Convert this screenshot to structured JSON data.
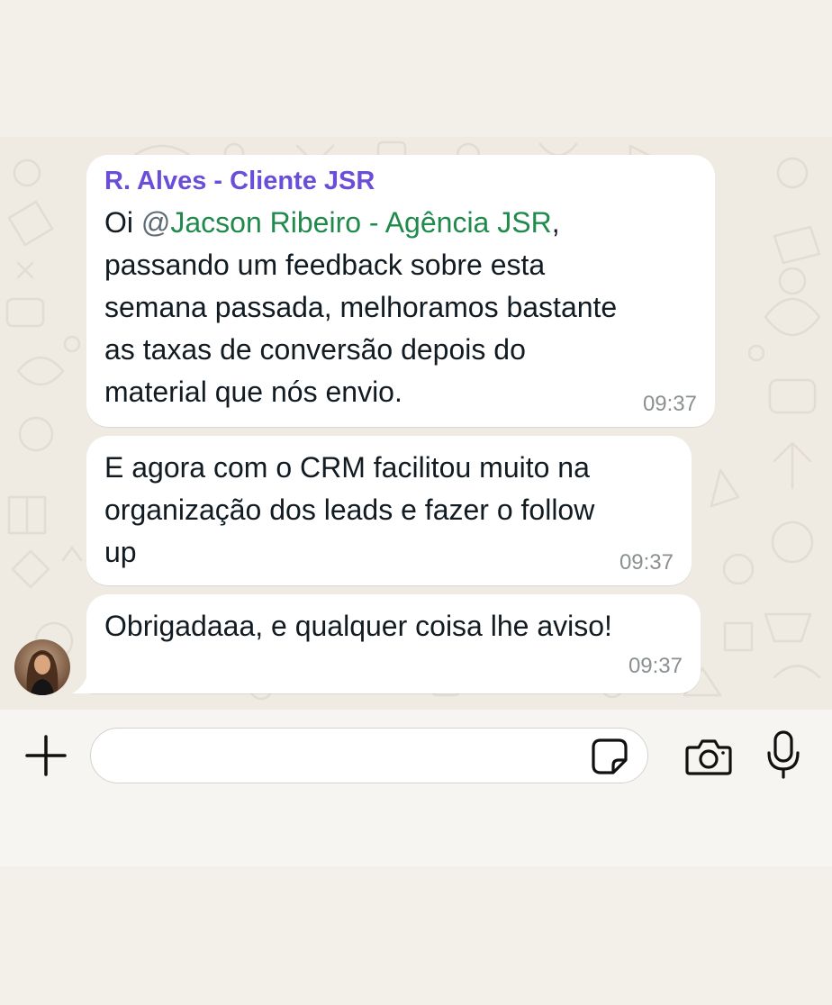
{
  "messages": [
    {
      "sender": "R. Alves - Cliente JSR",
      "mention_at": "@",
      "mention_name": "Jacson Ribeiro - Agência JSR",
      "line1_prefix": "Oi ",
      "line1_suffix": ",",
      "lines": [
        "passando um feedback sobre esta",
        "semana passada, melhoramos bastante",
        "as taxas de conversão depois do",
        "material que nós envio."
      ],
      "time": "09:37"
    },
    {
      "lines": [
        "E agora com o CRM facilitou muito na",
        "organização dos leads e fazer o follow",
        "up"
      ],
      "time": "09:37"
    },
    {
      "lines": [
        "Obrigadaaa, e qualquer coisa lhe aviso!"
      ],
      "time": "09:37"
    }
  ],
  "composer": {
    "placeholder": ""
  },
  "icons": {
    "attach": "plus-icon",
    "sticker": "sticker-icon",
    "camera": "camera-icon",
    "mic": "microphone-icon"
  },
  "colors": {
    "sender": "#6a4ed8",
    "mention": "#1f8a4c",
    "chat_background": "#efeae2",
    "bubble": "#ffffff",
    "timestamp": "#8a8f92"
  }
}
